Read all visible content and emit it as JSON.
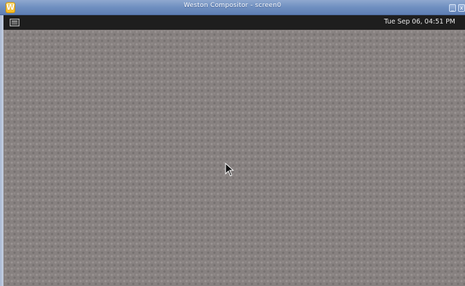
{
  "window": {
    "title": "Weston Compositor - screen0",
    "app_icon_letter": "W",
    "minimize_glyph": "_",
    "close_glyph": "x"
  },
  "panel": {
    "launcher_icon": "terminal-launcher-icon",
    "clock": "Tue Sep 06, 04:51 PM"
  },
  "colors": {
    "titlebar": "#6f8fc0",
    "panel": "#1e1e1e",
    "desktop": "#878180"
  }
}
